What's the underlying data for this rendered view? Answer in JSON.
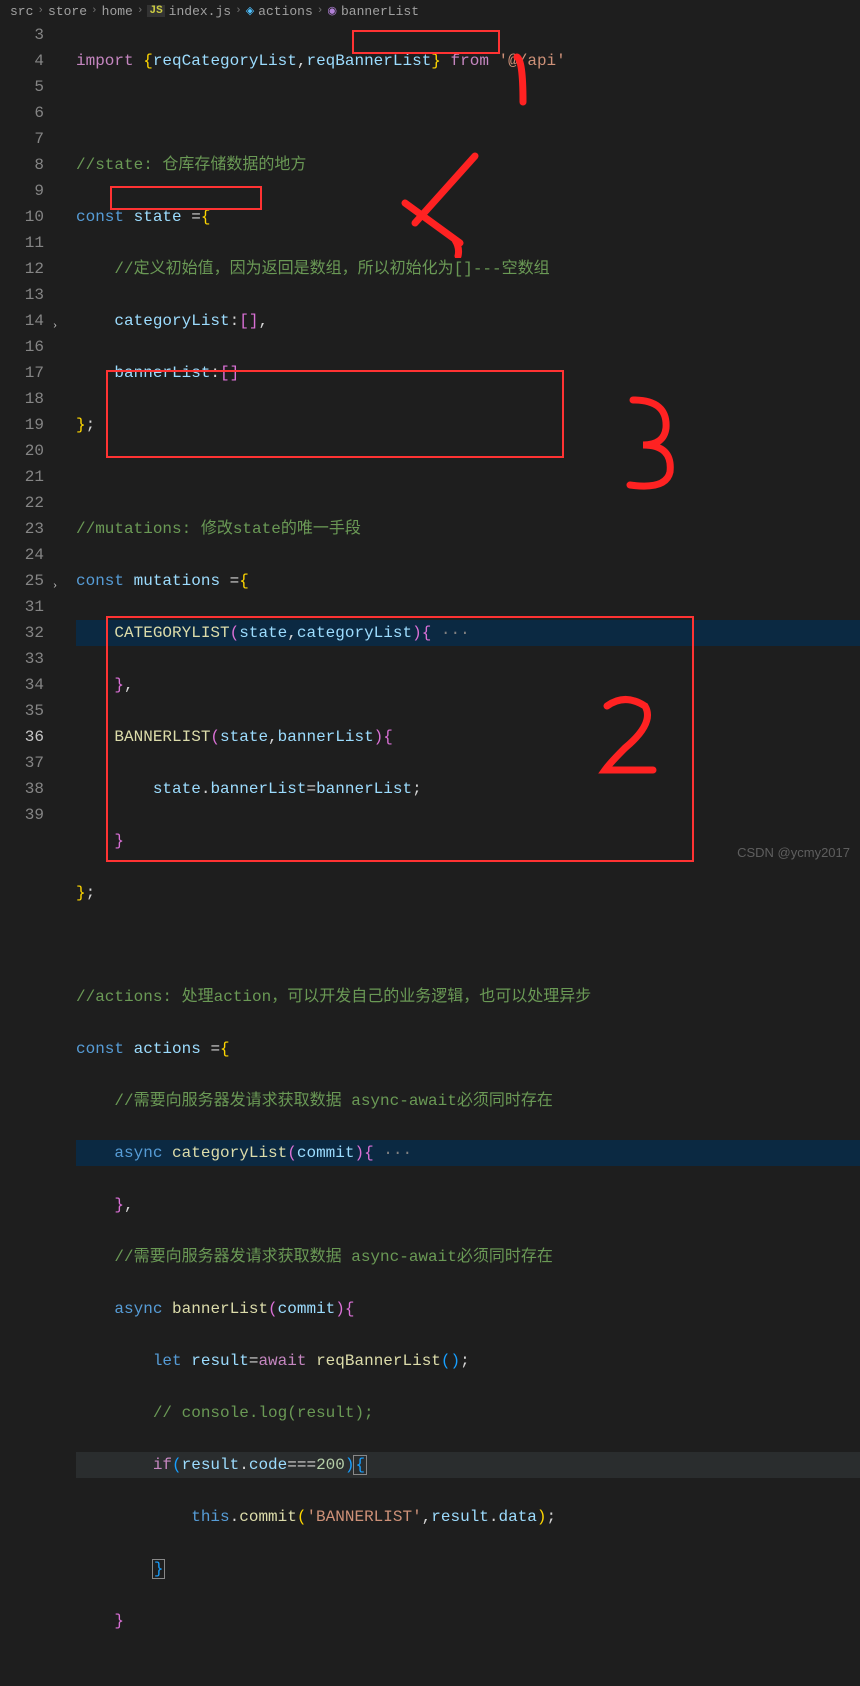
{
  "breadcrumb": {
    "parts": [
      "src",
      "store",
      "home",
      "index.js",
      "actions",
      "bannerList"
    ],
    "js_label": "JS"
  },
  "gutter": {
    "lines": [
      "3",
      "4",
      "5",
      "6",
      "7",
      "8",
      "9",
      "10",
      "11",
      "12",
      "13",
      "14",
      "16",
      "17",
      "18",
      "19",
      "20",
      "21",
      "22",
      "23",
      "24",
      "25",
      "31",
      "32",
      "33",
      "34",
      "35",
      "36",
      "37",
      "38",
      "39"
    ]
  },
  "code": {
    "l3_import": "import",
    "l3_o": "{",
    "l3_a": "reqCategoryList",
    "l3_c": ",",
    "l3_b": "reqBannerList",
    "l3_cl": "}",
    "l3_from": "from",
    "l3_str": "'@/api'",
    "l5": "//state: 仓库存储数据的地方",
    "l6_const": "const",
    "l6_var": "state",
    "l6_eq": " =",
    "l6_o": "{",
    "l7": "//定义初始值，因为返回是数组，所以初始化为[]---空数组",
    "l8_prop": "categoryList",
    "l8_colon": ":",
    "l8_br": "[]",
    "l8_c": ",",
    "l9_prop": "bannerList",
    "l9_colon": ":",
    "l9_br": "[]",
    "l10_c": "}",
    "l10_s": ";",
    "l12": "//mutations: 修改state的唯一手段",
    "l13_const": "const",
    "l13_var": "mutations",
    "l13_eq": " =",
    "l13_o": "{",
    "l14_fn": "CATEGORYLIST",
    "l14_p": "(",
    "l14_a": "state",
    "l14_c": ",",
    "l14_b": "categoryList",
    "l14_cp": ")",
    "l14_o": "{",
    "l14_d": " ···",
    "l16_c": "}",
    "l16_cm": ",",
    "l17_fn": "BANNERLIST",
    "l17_p": "(",
    "l17_a": "state",
    "l17_c": ",",
    "l17_b": "bannerList",
    "l17_cp": ")",
    "l17_o": "{",
    "l18_a": "state",
    "l18_dot": ".",
    "l18_b": "bannerList",
    "l18_eq": "=",
    "l18_c": "bannerList",
    "l18_s": ";",
    "l19_c": "}",
    "l20_c": "}",
    "l20_s": ";",
    "l22": "//actions: 处理action，可以开发自己的业务逻辑，也可以处理异步",
    "l23_const": "const",
    "l23_var": "actions",
    "l23_eq": " =",
    "l23_o": "{",
    "l24": "//需要向服务器发请求获取数据 async-await必须同时存在",
    "l25_async": "async",
    "l25_fn": "categoryList",
    "l25_p": "(",
    "l25_a": "commit",
    "l25_cp": ")",
    "l25_o": "{",
    "l25_d": " ···",
    "l31_c": "}",
    "l31_cm": ",",
    "l32": "//需要向服务器发请求获取数据 async-await必须同时存在",
    "l33_async": "async",
    "l33_fn": "bannerList",
    "l33_p": "(",
    "l33_a": "commit",
    "l33_cp": ")",
    "l33_o": "{",
    "l34_let": "let",
    "l34_var": "result",
    "l34_eq": "=",
    "l34_await": "await",
    "l34_fn": "reqBannerList",
    "l34_p": "()",
    "l34_s": ";",
    "l35": "// console.log(result);",
    "l36_if": "if",
    "l36_p": "(",
    "l36_a": "result",
    "l36_dot": ".",
    "l36_b": "code",
    "l36_eq": "===",
    "l36_n": "200",
    "l36_cp": ")",
    "l36_o": "{",
    "l37_this": "this",
    "l37_dot": ".",
    "l37_fn": "commit",
    "l37_p": "(",
    "l37_str": "'BANNERLIST'",
    "l37_c": ",",
    "l37_a": "result",
    "l37_dot2": ".",
    "l37_b": "data",
    "l37_cp": ")",
    "l37_s": ";",
    "l38_c": "}",
    "l39_c": "}"
  },
  "annotations": {
    "n1": "1",
    "n2": "2",
    "n3": "3",
    "n4": "4"
  },
  "watermark": "CSDN @ycmy2017"
}
